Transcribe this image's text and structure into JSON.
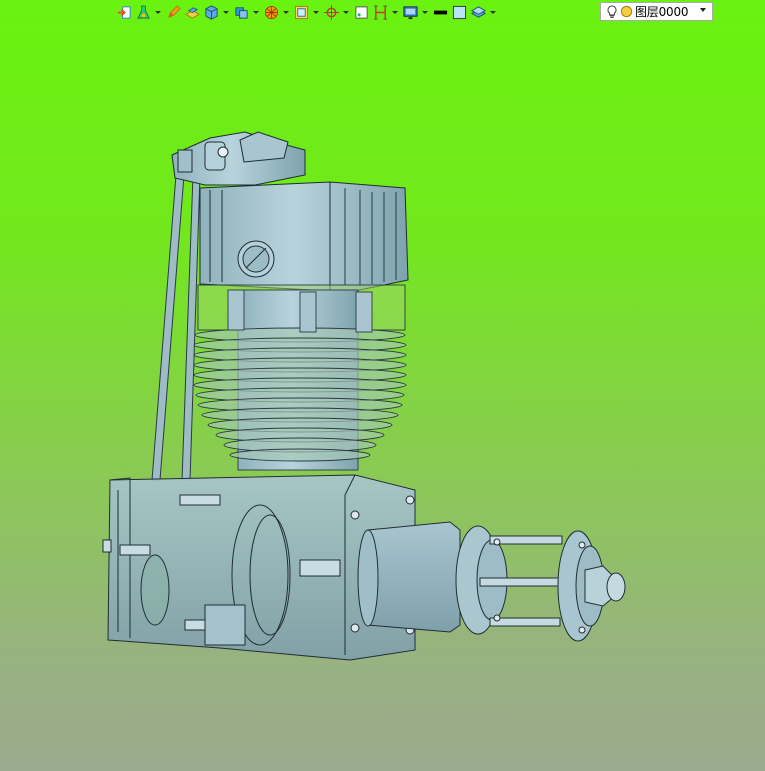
{
  "toolbar": {
    "tools": [
      {
        "icon": "import-icon",
        "has_dropdown": false
      },
      {
        "icon": "modify-flask-icon",
        "has_dropdown": true
      },
      {
        "icon": "pencil-icon",
        "has_dropdown": false
      },
      {
        "icon": "plane-box-icon",
        "has_dropdown": false
      },
      {
        "icon": "cube-icon",
        "has_dropdown": true
      },
      {
        "icon": "solid-stack-icon",
        "has_dropdown": true
      },
      {
        "icon": "sphere-section-icon",
        "has_dropdown": true
      },
      {
        "icon": "frame-view-icon",
        "has_dropdown": true
      },
      {
        "icon": "crosshair-icon",
        "has_dropdown": true
      },
      {
        "icon": "dimension-box-icon",
        "has_dropdown": false
      },
      {
        "icon": "height-gauge-icon",
        "has_dropdown": true
      },
      {
        "icon": "monitor-render-icon",
        "has_dropdown": true
      },
      {
        "icon": "line-color-icon",
        "has_dropdown": false
      },
      {
        "icon": "fill-color-icon",
        "has_dropdown": false
      },
      {
        "icon": "layer-stack-icon",
        "has_dropdown": true
      }
    ],
    "colors": {
      "line_color": "#000000",
      "fill_color": "#b7e3f5",
      "accent_orange": "#f39c12",
      "accent_blue": "#2e86de"
    }
  },
  "layer": {
    "current": "图层0000",
    "visible_icon": "lightbulb-icon",
    "frozen_icon": "sun-icon"
  }
}
